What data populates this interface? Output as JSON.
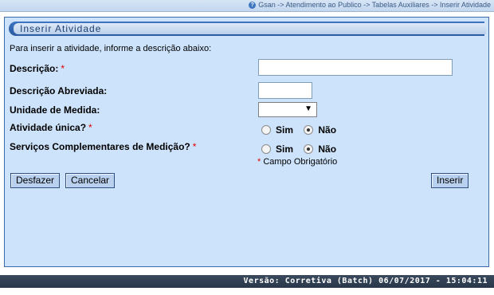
{
  "breadcrumb": "Gsan -> Atendimento ao Publico -> Tabelas Auxiliares -> Inserir Atividade",
  "panel_title": "Inserir Atividade",
  "intro": "Para inserir a atividade, informe a descrição abaixo:",
  "fields": {
    "descricao": {
      "label": "Descrição:",
      "required_mark": "*",
      "value": ""
    },
    "descricao_abreviada": {
      "label": "Descrição Abreviada:",
      "value": ""
    },
    "unidade_medida": {
      "label": "Unidade de Medida:",
      "selected": ""
    },
    "atividade_unica": {
      "label": "Atividade única?",
      "required_mark": "*",
      "options": [
        "Sim",
        "Não"
      ],
      "selected": "Não"
    },
    "servicos_complementares": {
      "label": "Serviços Complementares de Medição?",
      "required_mark": "*",
      "options": [
        "Sim",
        "Não"
      ],
      "selected": "Não"
    }
  },
  "required_note": {
    "star": "*",
    "text": "Campo Obrigatório"
  },
  "buttons": {
    "desfazer": "Desfazer",
    "cancelar": "Cancelar",
    "inserir": "Inserir"
  },
  "footer_version": "Versão: Corretiva (Batch) 06/07/2017 - 15:04:11",
  "icons": {
    "help": "help-icon",
    "dropdown": "chevron-down-icon"
  },
  "colors": {
    "panel_bg": "#cde3fb",
    "header_blue": "#2b5aa0",
    "required": "#e00000",
    "footer_bg": "#28374a"
  }
}
